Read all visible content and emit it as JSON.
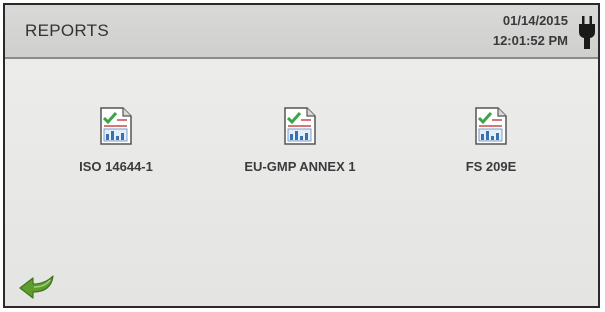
{
  "header": {
    "title": "REPORTS",
    "date": "01/14/2015",
    "time": "12:01:52 PM",
    "power_icon": "plug-icon"
  },
  "reports": [
    {
      "label": "ISO 14644-1",
      "icon": "report-document-icon"
    },
    {
      "label": "EU-GMP ANNEX 1",
      "icon": "report-document-icon"
    },
    {
      "label": "FS 209E",
      "icon": "report-document-icon"
    }
  ],
  "footer": {
    "back_icon": "back-arrow-icon"
  },
  "colors": {
    "background": "#e8e8e6",
    "header": "#d4d4d2",
    "text": "#333335",
    "check_green": "#3aa544",
    "back_arrow_green": "#5c9d2e"
  }
}
